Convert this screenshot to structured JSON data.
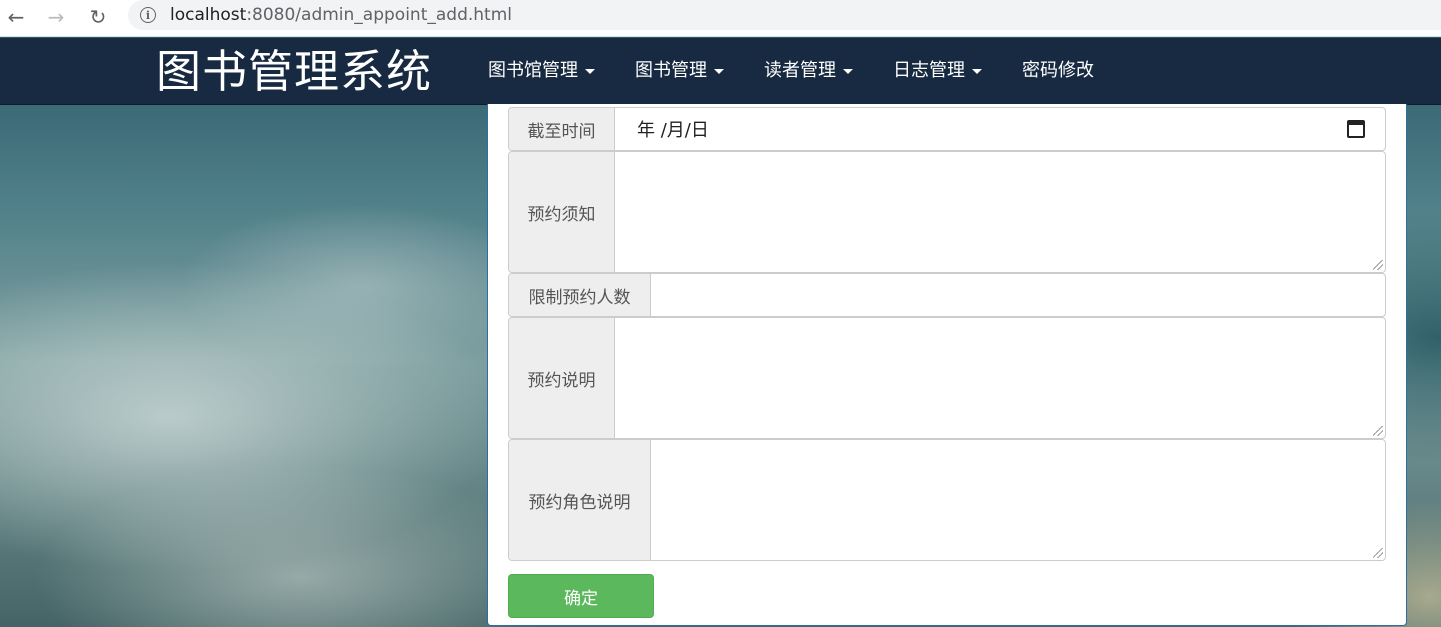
{
  "browser": {
    "back_icon": "←",
    "forward_icon": "→",
    "reload_icon": "↻",
    "url_host": "localhost",
    "url_path": ":8080/admin_appoint_add.html"
  },
  "navbar": {
    "brand": "图书管理系统",
    "menu": [
      {
        "label": "图书馆管理",
        "dropdown": true
      },
      {
        "label": "图书管理",
        "dropdown": true
      },
      {
        "label": "读者管理",
        "dropdown": true
      },
      {
        "label": "日志管理",
        "dropdown": true
      },
      {
        "label": "密码修改",
        "dropdown": false
      }
    ],
    "background": "#172a41"
  },
  "form": {
    "deadline": {
      "label": "截至时间",
      "value": "年 /月/日"
    },
    "notice": {
      "label": "预约须知",
      "value": ""
    },
    "limit": {
      "label": "限制预约人数",
      "value": ""
    },
    "description": {
      "label": "预约说明",
      "value": ""
    },
    "role_description": {
      "label": "预约角色说明",
      "value": ""
    },
    "submit_label": "确定",
    "submit_color": "#5cb85c"
  }
}
